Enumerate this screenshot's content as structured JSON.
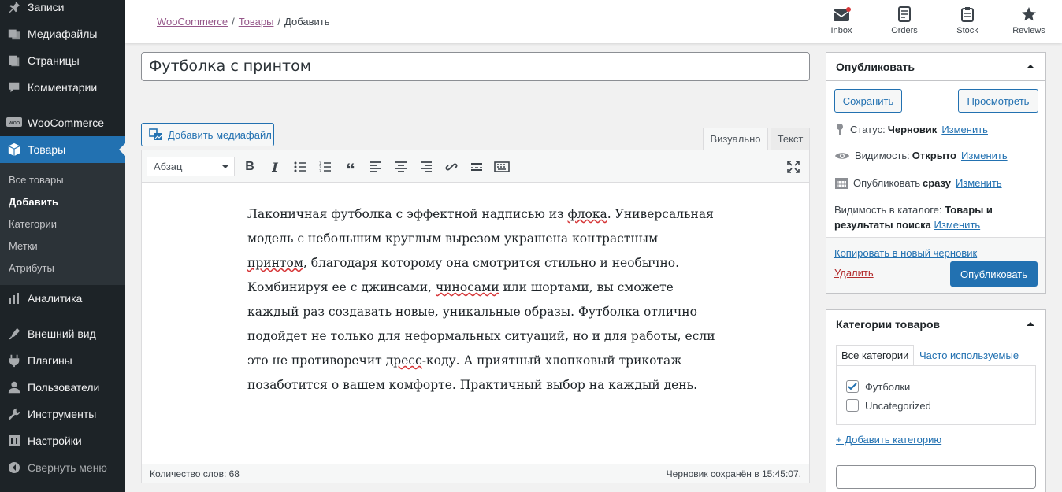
{
  "sidebar": {
    "items": [
      {
        "label": "Записи",
        "icon": "pin-icon"
      },
      {
        "label": "Медиафайлы",
        "icon": "media-icon"
      },
      {
        "label": "Страницы",
        "icon": "pages-icon"
      },
      {
        "label": "Комментарии",
        "icon": "comments-icon"
      },
      {
        "label": "WooCommerce",
        "icon": "woo-icon"
      },
      {
        "label": "Товары",
        "icon": "products-icon"
      },
      {
        "label": "Аналитика",
        "icon": "analytics-icon"
      },
      {
        "label": "Внешний вид",
        "icon": "appearance-icon"
      },
      {
        "label": "Плагины",
        "icon": "plugins-icon"
      },
      {
        "label": "Пользователи",
        "icon": "users-icon"
      },
      {
        "label": "Инструменты",
        "icon": "tools-icon"
      },
      {
        "label": "Настройки",
        "icon": "settings-icon"
      }
    ],
    "submenu": [
      "Все товары",
      "Добавить",
      "Категории",
      "Метки",
      "Атрибуты"
    ],
    "collapse_label": "Свернуть меню"
  },
  "header": {
    "breadcrumb": {
      "root": "WooCommerce",
      "parent": "Товары",
      "current": "Добавить",
      "separator": "/"
    },
    "actions": [
      {
        "label": "Inbox",
        "icon": "inbox-icon"
      },
      {
        "label": "Orders",
        "icon": "orders-icon"
      },
      {
        "label": "Stock",
        "icon": "stock-icon"
      },
      {
        "label": "Reviews",
        "icon": "star-icon"
      }
    ]
  },
  "editor": {
    "title": "Футболка с принтом",
    "add_media_label": "Добавить медиафайл",
    "tabs": {
      "visual": "Визуально",
      "text": "Текст"
    },
    "format_select": "Абзац",
    "content_segments": [
      {
        "text": "Лаконичная футболка с эффектной надписью из ",
        "err": false
      },
      {
        "text": "флока",
        "err": true
      },
      {
        "text": ". Универсальная модель с небольшим круглым вырезом украшена контрастным ",
        "err": false
      },
      {
        "text": "принтом",
        "err": true
      },
      {
        "text": ", благодаря которому она смотрится стильно и необычно. Комбинируя ее с джинсами, ",
        "err": false
      },
      {
        "text": "чиносами",
        "err": true
      },
      {
        "text": " или шортами, вы сможете каждый раз создавать новые, уникальные образы. Футболка отлично подойдет не только для неформальных ситуаций, но и для работы, если это не противоречит ",
        "err": false
      },
      {
        "text": "дресс",
        "err": true
      },
      {
        "text": "-коду. А приятный хлопковый трикотаж позаботится о вашем комфорте. Практичный выбор на каждый день.",
        "err": false
      }
    ],
    "word_count": "Количество слов: 68",
    "autosave": "Черновик сохранён в 15:45:07."
  },
  "publish": {
    "title": "Опубликовать",
    "save_label": "Сохранить",
    "preview_label": "Просмотреть",
    "status_label": "Статус:",
    "status_value": "Черновик",
    "visibility_label": "Видимость:",
    "visibility_value": "Открыто",
    "schedule_label": "Опубликовать",
    "schedule_value": "сразу",
    "edit_link": "Изменить",
    "catalog_label": "Видимость в каталоге:",
    "catalog_value": "Товары и результаты поиска",
    "copy_link": "Копировать в новый черновик",
    "delete_link": "Удалить",
    "publish_label": "Опубликовать"
  },
  "categories": {
    "title": "Категории товаров",
    "tab_all": "Все категории",
    "tab_popular": "Часто используемые",
    "items": [
      {
        "label": "Футболки",
        "checked": true
      },
      {
        "label": "Uncategorized",
        "checked": false
      }
    ],
    "add_link": "+ Добавить категорию",
    "colors": {
      "accent": "#2271b1",
      "woo": "#96588a",
      "delete": "#b32d2e"
    }
  }
}
